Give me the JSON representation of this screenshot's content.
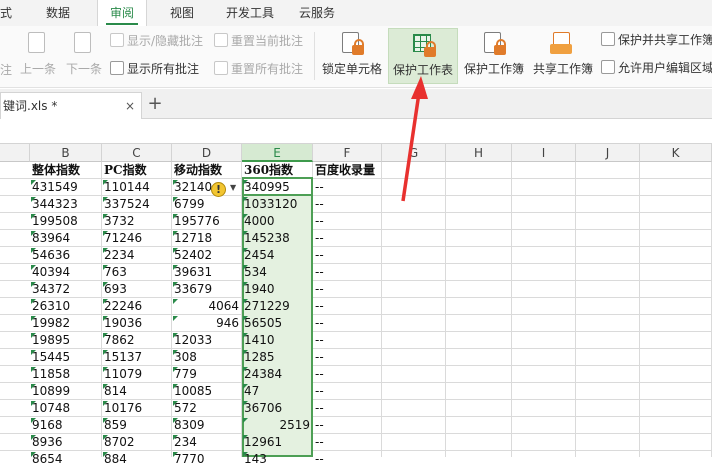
{
  "menu": {
    "tabs": [
      "式",
      "数据",
      "审阅",
      "视图",
      "开发工具",
      "云服务"
    ],
    "active": "审阅"
  },
  "ribbon": {
    "prev_label": "上一条",
    "next_label": "下一条",
    "show_hide_comment": "显示/隐藏批注",
    "reset_current_comment": "重置当前批注",
    "show_all_comments": "显示所有批注",
    "reset_all_comments": "重置所有批注",
    "lock_cell": "锁定单元格",
    "protect_sheet": "保护工作表",
    "protect_workbook": "保护工作簿",
    "share_workbook": "共享工作簿",
    "protect_and_share": "保护并共享工作簿",
    "allow_edit_ranges": "允许用户编辑区域",
    "left_cut": "注",
    "hovered_button": "保护工作表"
  },
  "document_tab": {
    "name": "键词.xls *",
    "close": "×",
    "add": "+"
  },
  "sheet": {
    "column_headers": [
      "B",
      "C",
      "D",
      "E",
      "F",
      "G",
      "H",
      "I",
      "J",
      "K"
    ],
    "selected_column": "E",
    "header_row": [
      "整体指数",
      "PC指数",
      "移动指数",
      "360指数",
      "百度收录量"
    ],
    "rows": [
      [
        "431549",
        "110144",
        "32140",
        "340995",
        "--"
      ],
      [
        "344323",
        "337524",
        "6799",
        "1033120",
        "--"
      ],
      [
        "199508",
        "3732",
        "195776",
        "4000",
        "--"
      ],
      [
        "83964",
        "71246",
        "12718",
        "145238",
        "--"
      ],
      [
        "54636",
        "2234",
        "52402",
        "2454",
        "--"
      ],
      [
        "40394",
        "763",
        "39631",
        "534",
        "--"
      ],
      [
        "34372",
        "693",
        "33679",
        "1940",
        "--"
      ],
      [
        "26310",
        "22246",
        "4064",
        "271229",
        "--"
      ],
      [
        "19982",
        "19036",
        "946",
        "56505",
        "--"
      ],
      [
        "19895",
        "7862",
        "12033",
        "1410",
        "--"
      ],
      [
        "15445",
        "15137",
        "308",
        "1285",
        "--"
      ],
      [
        "11858",
        "11079",
        "779",
        "24384",
        "--"
      ],
      [
        "10899",
        "814",
        "10085",
        "47",
        "--"
      ],
      [
        "10748",
        "10176",
        "572",
        "36706",
        "--"
      ],
      [
        "9168",
        "859",
        "8309",
        "2519",
        "--"
      ],
      [
        "8936",
        "8702",
        "234",
        "12961",
        "--"
      ],
      [
        "8654",
        "884",
        "7770",
        "143",
        "--"
      ]
    ],
    "warning_icon": "warning-icon"
  },
  "colors": {
    "accent": "#2a8a4a",
    "selection": "#e4f1e0",
    "arrow": "#e8312f"
  }
}
